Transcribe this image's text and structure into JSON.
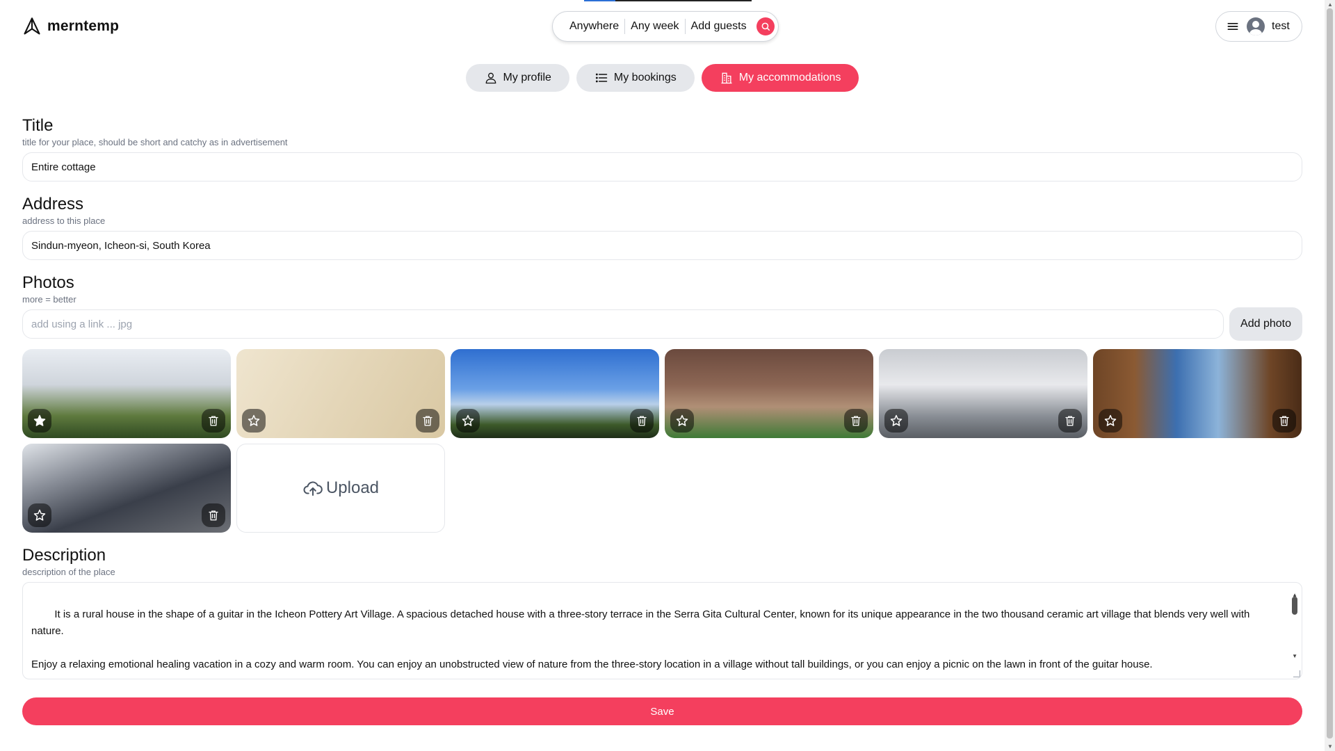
{
  "header": {
    "logo_text": "merntemp",
    "search": {
      "anywhere": "Anywhere",
      "any_week": "Any week",
      "add_guests": "Add guests"
    },
    "user_name": "test"
  },
  "tabs": [
    {
      "label": "My profile",
      "icon": "user-icon",
      "active": false
    },
    {
      "label": "My bookings",
      "icon": "list-icon",
      "active": false
    },
    {
      "label": "My accommodations",
      "icon": "building-icon",
      "active": true
    }
  ],
  "form": {
    "title": {
      "label": "Title",
      "hint": "title for your place, should be short and catchy as in advertisement",
      "value": "Entire cottage"
    },
    "address": {
      "label": "Address",
      "hint": "address to this place",
      "value": "Sindun-myeon, Icheon-si, South Korea"
    },
    "photos": {
      "label": "Photos",
      "hint": "more = better",
      "link_placeholder": "add using a link ... jpg",
      "add_button": "Add photo",
      "upload_label": "Upload",
      "items": [
        {
          "featured": true
        },
        {
          "featured": false
        },
        {
          "featured": false
        },
        {
          "featured": false
        },
        {
          "featured": false
        },
        {
          "featured": false
        },
        {
          "featured": false
        }
      ]
    },
    "description": {
      "label": "Description",
      "hint": "description of the place",
      "value": "It is a rural house in the shape of a guitar in the Icheon Pottery Art Village. A spacious detached house with a three-story terrace in the Serra Gita Cultural Center, known for its unique appearance in the two thousand ceramic art village that blends very well with nature.\n\nEnjoy a relaxing emotional healing vacation in a cozy and warm room. You can enjoy an unobstructed view of nature from the three-story location in a village without tall buildings, or you can enjoy a picnic on the lawn in front of the guitar house.\n\nIf you wish, you can book a"
    },
    "save_button": "Save"
  },
  "colors": {
    "accent": "#f43f5e",
    "tab_inactive": "#e5e7eb"
  }
}
